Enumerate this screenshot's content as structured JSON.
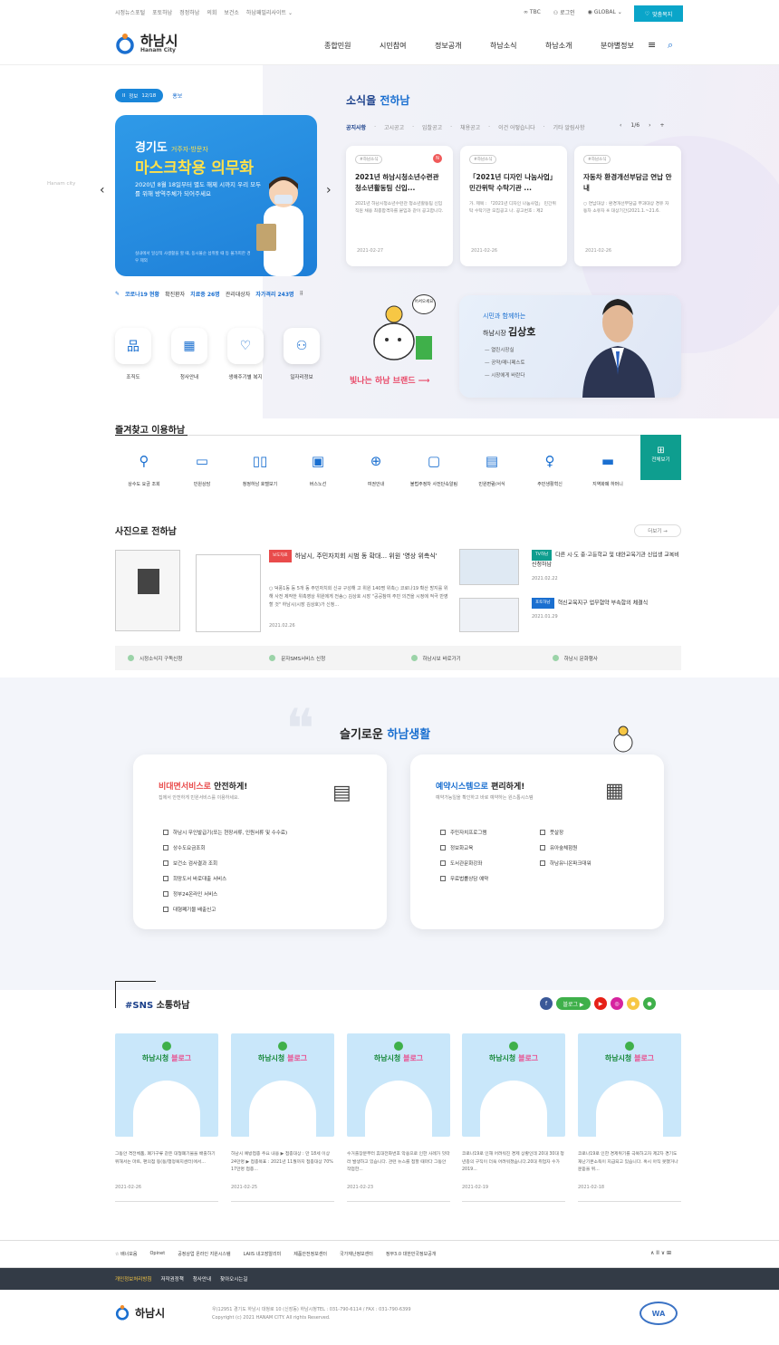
{
  "util": {
    "left_links": [
      "시정뉴스포털",
      "포토하남",
      "정정하남",
      "의회",
      "보건소",
      "하남패밀리사이트 ⌄"
    ],
    "tbc": "TBC",
    "login": "로그인",
    "global": "GLOBAL ⌄",
    "custom": "맞춤복지"
  },
  "header": {
    "logo_ko": "하남시",
    "logo_en": "Hanam City",
    "menu": [
      "종합민원",
      "시민참여",
      "정보공개",
      "하남소식",
      "하남소개",
      "분야별정보"
    ]
  },
  "banner": {
    "pill_label": "정보",
    "pill_count": "12/18",
    "pill_pause": "II",
    "promo": "홍보",
    "h1": "경기도",
    "h1_small": "거주자·방문자",
    "h2": "마스크착용 의무화",
    "p": "2020년 8월 18일부터 별도 해제 시까지 우리 모두를 위해 방역주체가 되어주세요",
    "fine": "실내에서 일상적 사생활을 할 때, 동시불순 섭취할 때 등 불가피한 경우 제외",
    "side_tag": "Hanam city"
  },
  "covid": {
    "label": "코로나19 현황",
    "text1": "확진환자",
    "v1": "치료중 26명",
    "text2": "관리대상자",
    "v2": "자가격리 243명"
  },
  "quick": [
    "조직도",
    "청사안내",
    "생애주기별 복지",
    "일자리정보"
  ],
  "news": {
    "title_a": "소식을",
    "title_b": "전하남",
    "tabs": [
      "공지사항",
      "고시공고",
      "입찰공고",
      "채용공고",
      "이건 어떻습니다",
      "기타 알림사항"
    ],
    "page": "1/6",
    "cards": [
      {
        "tag": "#하남소식",
        "title": "2021년 하남시청소년수련관 청소년활동팀 신입...",
        "desc": "2021년 하남시청소년수련관 청소년활동팀 신입직원 채용 최종합격자를 붙임과 같이 공고합니다.",
        "date": "2021-02-27",
        "new": "N"
      },
      {
        "tag": "#하남소식",
        "title": "「2021년 디자인 나눔사업」 민간위탁 수탁기관 ...",
        "desc": "가. 제목 : 「2021년 디자인 나눔사업」 민간위탁 수탁기관 모집공고 나. 공고번호 : 제2",
        "date": "2021-02-26",
        "new": ""
      },
      {
        "tag": "#하남소식",
        "title": "자동차 환경개선부담금 연납 안내",
        "desc": "○ 연납대상 : 환경개선부담금 부과대상 경유 자동차 소유자 ※ 대상기간(2021.1.~21.6.",
        "date": "2021-02-26",
        "new": ""
      }
    ]
  },
  "brand": {
    "text": "빛나는 하남 브랜드 ⟶",
    "bubble": "어서오세요"
  },
  "mayor": {
    "line1": "시민과 함께하는",
    "line2a": "하남시장",
    "line2b": "김상호",
    "links": [
      "열린시장실",
      "공약/매니페스토",
      "시장에게 바란다"
    ]
  },
  "fav": {
    "title": "즐겨찾고 이용하남",
    "items": [
      "상수도 요금 조회",
      "민원상담",
      "청정하남 호텔보기",
      "버스노선",
      "여권안내",
      "불법주정차 사전단속알림",
      "민원편람/서식",
      "주민생활혁신",
      "지역화폐 하머니"
    ],
    "all_icon": "⊞",
    "all": "전체보기"
  },
  "photo": {
    "title": "사진으로 전하남",
    "more": "더보기 →",
    "main_badge": "보도자료",
    "main_title": "하남시, 주민자치회 시범 동 확대... 위원 '영상 위촉식'",
    "main_desc": "○ 덕풍1동 등 5개 동 주민자치회 신규 구성해 고 위원 140명 위촉○ 코로나19 확산 방지를 위해 사전 제작한 위촉영상 위원에게 전송○ 김상호 시장 \"공공참여 주민 의견을 시정에 적극 반영할 것\" 하남시(시장 김상호)가 신청...",
    "main_date": "2021.02.26",
    "s1_badge": "TV하남",
    "s1_title": "다른 시·도 중·고등학교 및 대안교육기관 신입생 교복비 신청하남",
    "s1_date": "2021.02.22",
    "s2_badge": "포토하남",
    "s2_title": "혁신교육지구 업무협약 부속합의 체결식",
    "s2_date": "2021.01.29"
  },
  "links": [
    "시정소식지 구독신청",
    "문자SMS서비스 신청",
    "하남시보 바로가기",
    "하남시 문화행사"
  ],
  "life": {
    "title_a": "슬기로운",
    "title_b": "하남생활",
    "c1_h_a": "비대면서비스로",
    "c1_h_b": "안전하게!",
    "c1_s": "집에서 안전하게 민원서비스를 이용하세요.",
    "c1_items": [
      "하남시 무인발급기(또는 현장서류, 인원서류 및 수수료)",
      "상수도요금조회",
      "보건소 검사결과 조회",
      "희망도서 바로대출 서비스",
      "정부24온라인 서비스",
      "대형폐기물 배출신고"
    ],
    "c2_h_a": "예약시스템으로",
    "c2_h_b": "편리하게!",
    "c2_s": "예약가능일을 확인하고 바로 예약하는 원스톱시스템",
    "c2_items_l": [
      "주민자치프로그램",
      "정보화교육",
      "도서관문화강좌",
      "무료법률상담 예약"
    ],
    "c2_items_r": [
      "풋살장",
      "유아숲체험원",
      "하남유니온파크대워"
    ]
  },
  "sns": {
    "title_a": "#SNS",
    "title_b": "소통하남",
    "blog_btn": "블로그 ▶",
    "icons": [
      "f",
      "▶",
      "◎",
      "●",
      "●"
    ],
    "colors": [
      "#3b5998",
      "#e62117",
      "#d6249f",
      "#f7c744",
      "#3fb04a"
    ],
    "blog_label_a": "하남시청",
    "blog_label_b": "블로그",
    "posts": [
      {
        "text": "그동안 격전체품, 폐가구류 같은 대형폐기물을 배출하기 위해서는 마트, 편의점 등(동/행정복지센터)에서...",
        "date": "2021-02-26"
      },
      {
        "text": "하남시 예방접종 주요 내용 ▶ 접종대상 : 만 18세 이상 24만명 ▶ 접종목표 : 2021년 11월까지 접종대상 70% 17만명 접종...",
        "date": "2021-02-25"
      },
      {
        "text": "수거출장분부터 휴대전화번호 악용으로 인한 사례가 잇따라 발생하고 있습니다. 관련 뉴스를 접할 때마다 그동안 작업한...",
        "date": "2021-02-23"
      },
      {
        "text": "코로나19로 인해 어려워진 경제 상황인데 20대 30대 청년층의 구직이 더욱 어려워졌습니다.20대 취업자 수가 2019...",
        "date": "2021-02-19"
      },
      {
        "text": "코로나19로 인한 경제위기를 극복하고자 제2차 경기도 재난기본소득이 지급되고 있습니다. 혹시 아직 못했거나 문듣을 위...",
        "date": "2021-02-18"
      }
    ]
  },
  "footer": {
    "bn_label": "배너모음",
    "banners": [
      "Opinet",
      "공정상업 온라인 지원시스템",
      "LAIIS 내고장알리미",
      "제품안전정보센터",
      "국가재난정보센터",
      "정부3.0 대한민국정보공개"
    ],
    "bn_ctl": "∧ II ∨ ⊞",
    "nav": [
      "개인정보처리방침",
      "저작권정책",
      "청사안내",
      "찾아오시는길"
    ],
    "logo": "하남시",
    "addr1": "우)12951 경기도 하남시 대청로 10 (신장동) 하남시청TEL : 031-790-6114 / FAX : 031-790-6399",
    "addr2": "Copyright (c) 2021 HANAM CITY. All rights Reserved.",
    "wa": "WA"
  }
}
